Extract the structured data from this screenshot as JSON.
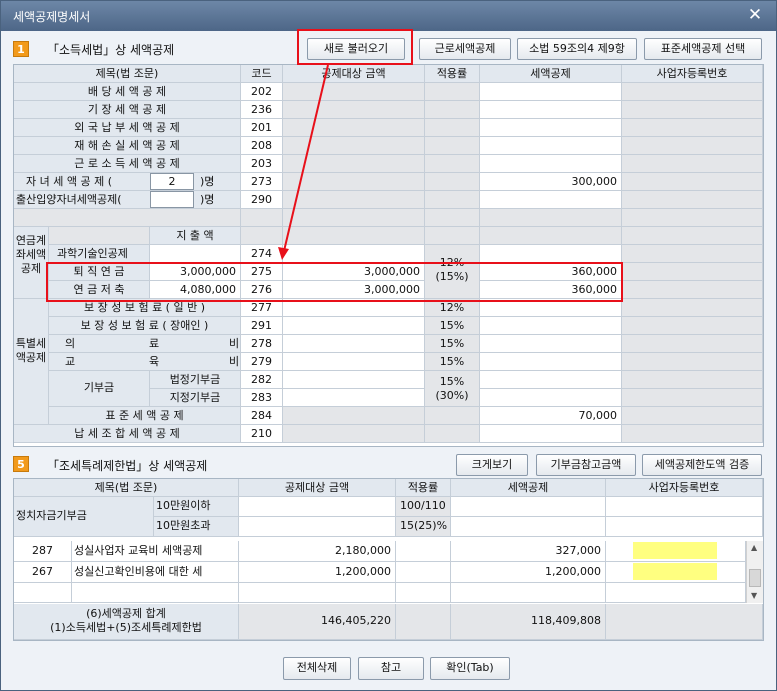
{
  "window": {
    "title": "세액공제명세서",
    "close_glyph": "✕"
  },
  "section1": {
    "number": "1",
    "title": "「소득세법」상 세액공제",
    "buttons": {
      "reload": "새로 불러오기",
      "earned": "근로세액공제",
      "art59": "소법 59조의4 제9항",
      "standard": "표준세액공제 선택"
    },
    "headers": {
      "item": "제목(법 조문)",
      "code": "코드",
      "target": "공제대상 금액",
      "rate": "적용률",
      "credit": "세액공제",
      "bizno": "사업자등록번호"
    },
    "rows": {
      "dividend": {
        "label": "배 당 세 액 공 제",
        "code": "202"
      },
      "bookkeeping": {
        "label": "기 장 세 액 공 제",
        "code": "236"
      },
      "foreign": {
        "label": "외 국 납 부 세 액 공 제",
        "code": "201"
      },
      "disaster": {
        "label": "재 해 손 실 세 액 공 제",
        "code": "208"
      },
      "earned": {
        "label": "근 로 소 득 세 액 공 제",
        "code": "203"
      },
      "child": {
        "label": "자 녀 세 액 공 제 (",
        "count": "2",
        "suffix": ")명",
        "code": "273",
        "credit": "300,000"
      },
      "birth": {
        "label": "출산입양자녀세액공제(",
        "count": "",
        "suffix": ")명",
        "code": "290"
      }
    },
    "pension": {
      "group_label": "연금계좌세액공제",
      "expense_header": "지 출 액",
      "tech": {
        "label": "과학기술인공제",
        "code": "274"
      },
      "retire": {
        "label": "퇴 직 연 금",
        "expense": "3,000,000",
        "code": "275",
        "target": "3,000,000",
        "credit": "360,000"
      },
      "saving": {
        "label": "연 금 저 축",
        "expense": "4,080,000",
        "code": "276",
        "target": "3,000,000",
        "credit": "360,000"
      },
      "rate": "12%",
      "rate2": "(15%)"
    },
    "special": {
      "group_label": "특별세액공제",
      "ins_general": {
        "label": "보 장 성 보 험 료 ( 일 반 )",
        "code": "277",
        "rate": "12%"
      },
      "ins_disabled": {
        "label": "보 장 성 보 험 료 ( 장애인 )",
        "code": "291",
        "rate": "15%"
      },
      "medical": {
        "label_a": "의",
        "label_b": "료",
        "label_c": "비",
        "code": "278",
        "rate": "15%"
      },
      "education": {
        "label_a": "교",
        "label_b": "육",
        "label_c": "비",
        "code": "279",
        "rate": "15%"
      },
      "donation_label": "기부금",
      "donation_legal": {
        "label": "법정기부금",
        "code": "282"
      },
      "donation_designated": {
        "label": "지정기부금",
        "code": "283"
      },
      "donation_rate": "15%",
      "donation_rate2": "(30%)",
      "standard": {
        "label": "표 준 세 액 공 제",
        "code": "284",
        "credit": "70,000"
      }
    },
    "tax_union": {
      "label": "납 세 조 합 세 액 공 제",
      "code": "210"
    }
  },
  "section5": {
    "number": "5",
    "title": "「조세특례제한법」상 세액공제",
    "buttons": {
      "enlarge": "크게보기",
      "donation_ref": "기부금참고금액",
      "limit_check": "세액공제한도액 검증"
    },
    "headers": {
      "item": "제목(법 조문)",
      "target": "공제대상 금액",
      "rate": "적용률",
      "credit": "세액공제",
      "bizno": "사업자등록번호"
    },
    "political": {
      "label": "정치자금기부금",
      "sub1": "10만원이하",
      "rate1": "100/110",
      "sub2": "10만원초과",
      "rate2": "15(25)%"
    },
    "list": [
      {
        "code": "287",
        "label": "성실사업자 교육비 세액공제",
        "target": "2,180,000",
        "credit": "327,000"
      },
      {
        "code": "267",
        "label": "성실신고확인비용에 대한 세",
        "target": "1,200,000",
        "credit": "1,200,000"
      }
    ],
    "total": {
      "label1": "(6)세액공제 합계",
      "label2": "(1)소득세법+(5)조세특례제한법",
      "target": "146,405,220",
      "credit": "118,409,808"
    }
  },
  "footer": {
    "delete_all": "전체삭제",
    "reference": "참고",
    "confirm": "확인(Tab)"
  },
  "colors": {
    "highlight": "#e8101a",
    "section_badge": "#f29a1b",
    "bizno_fill": "#ffff80"
  }
}
